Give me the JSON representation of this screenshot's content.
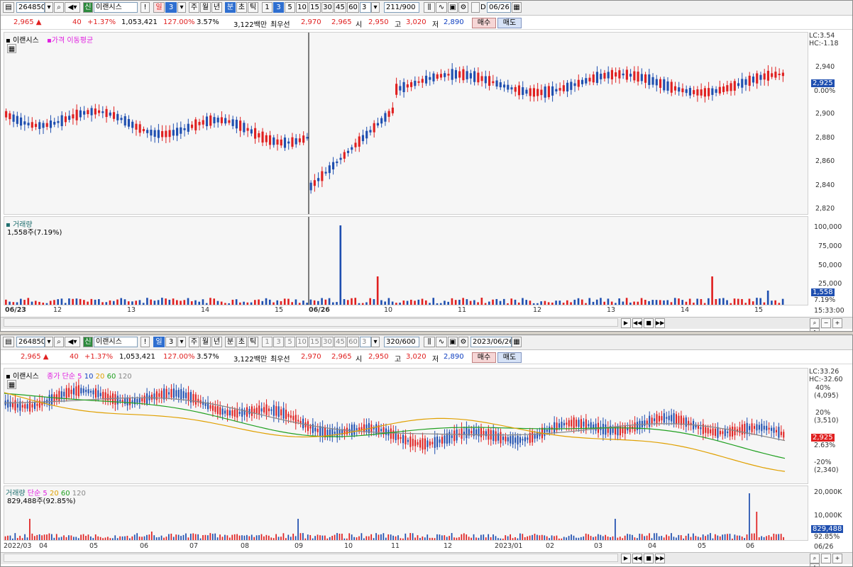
{
  "top": {
    "code": "264850",
    "stock_name": "이랜시스",
    "period_selected": "일",
    "period_count": "3",
    "periods": [
      "주",
      "월",
      "년",
      "분",
      "초",
      "틱"
    ],
    "minute_options": [
      "1",
      "3",
      "5",
      "10",
      "15",
      "30",
      "45",
      "60"
    ],
    "interval_value": "3",
    "range": "211/900",
    "date": "06/26",
    "info": {
      "price": "2,965 ▲",
      "change": "40",
      "change_pct": "+1.37%",
      "volume": "1,053,421",
      "vol_ratio": "127.00%",
      "turnover": "3.57%",
      "amount": "3,122백만",
      "best_label": "최우선",
      "ask": "2,970",
      "bid": "2,965",
      "open_label": "시",
      "open": "2,950",
      "high_label": "고",
      "high": "3,020",
      "low_label": "저",
      "low": "2,890",
      "buy": "매수",
      "sell": "매도"
    },
    "legend": {
      "name": "이랜시스",
      "ma": "가격 이동평균"
    },
    "price_axis": [
      "LC:3.54",
      "HC:-1.18",
      "2,940",
      "2,925",
      "0.00%",
      "2,900",
      "2,880",
      "2,860",
      "2,840",
      "2,820"
    ],
    "current_price": "2,925",
    "volume_legend": "거래량",
    "volume_value": "1,558주(7.19%)",
    "volume_axis": [
      "100,000",
      "75,000",
      "50,000",
      "25,000"
    ],
    "volume_box": "1,558",
    "volume_pct": "7.19%",
    "time_axis": [
      "06/23",
      "12",
      "13",
      "14",
      "15",
      "06/26",
      "10",
      "11",
      "12",
      "13",
      "14",
      "15"
    ],
    "time_right": "15:33:00",
    "signal_S": "S",
    "signal_B": "B"
  },
  "bottom": {
    "code": "264850",
    "stock_name": "이랜시스",
    "period_selected": "일",
    "period_count": "3",
    "periods": [
      "주",
      "월",
      "년",
      "분",
      "초",
      "틱"
    ],
    "minute_options": [
      "1",
      "3",
      "5",
      "10",
      "15",
      "30",
      "45",
      "60"
    ],
    "interval_value": "3",
    "range": "320/600",
    "date": "2023/06/26",
    "info": {
      "price": "2,965 ▲",
      "change": "40",
      "change_pct": "+1.37%",
      "volume": "1,053,421",
      "vol_ratio": "127.00%",
      "turnover": "3.57%",
      "amount": "3,122백만",
      "best_label": "최우선",
      "ask": "2,970",
      "bid": "2,965",
      "open_label": "시",
      "open": "2,950",
      "high_label": "고",
      "high": "3,020",
      "low_label": "저",
      "low": "2,890",
      "buy": "매수",
      "sell": "매도"
    },
    "legend": {
      "name": "이랜시스",
      "ma_label": "종가 단순",
      "ma_periods": [
        "5",
        "10",
        "20",
        "60",
        "120"
      ]
    },
    "price_axis": [
      "LC:33.26",
      "HC:-32.60",
      "40%",
      "(4,095)",
      "20%",
      "(3,510)",
      "2,925",
      "2.63%",
      "-20%",
      "(2,340)"
    ],
    "current_price": "2,925",
    "volume_legend": "거래량",
    "volume_ma_label": "단순",
    "volume_ma_periods": [
      "5",
      "20",
      "60",
      "120"
    ],
    "volume_value": "829,488주(92.85%)",
    "volume_axis": [
      "20,000K",
      "10,000K"
    ],
    "volume_box": "829,488",
    "volume_pct": "92.85%",
    "time_axis": [
      "2022/03",
      "04",
      "05",
      "06",
      "07",
      "08",
      "09",
      "10",
      "11",
      "12",
      "2023/01",
      "02",
      "03",
      "04",
      "05",
      "06"
    ],
    "time_right": "06/26"
  },
  "colors": {
    "up": "#e02020",
    "down": "#1f4fb0",
    "ma5": "#e020e0",
    "ma10": "#1040c0",
    "ma20": "#e0a000",
    "ma60": "#20a020",
    "ma120": "#888888"
  }
}
